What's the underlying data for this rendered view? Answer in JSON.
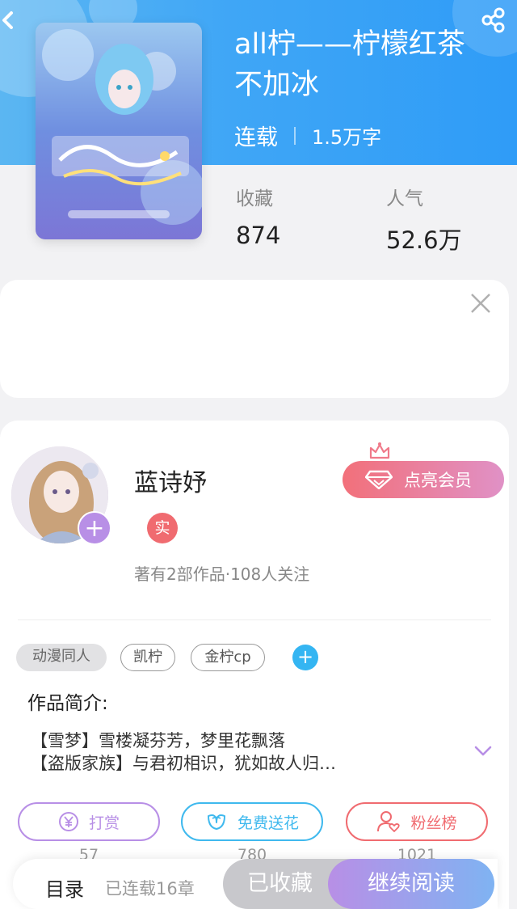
{
  "book": {
    "title": "all柠——柠檬红茶不加冰",
    "status": "连载",
    "word_count": "1.5万字",
    "stats": [
      {
        "label": "收藏",
        "value": "874"
      },
      {
        "label": "人气",
        "value": "52.6万"
      }
    ]
  },
  "author": {
    "name": "蓝诗妤",
    "verify_badge": "实",
    "info": "著有2部作品·108人关注",
    "vip_button": "点亮会员"
  },
  "tags": [
    "动漫同人",
    "凯柠",
    "金柠cp"
  ],
  "intro": {
    "title": "作品简介:",
    "lines": [
      "【雪梦】雪楼凝芬芳，梦里花飘落",
      "【盗版家族】与君初相识，犹如故人归…"
    ]
  },
  "actions": [
    {
      "label": "打赏",
      "count": "57",
      "color": "#b88fe6"
    },
    {
      "label": "免费送花",
      "count": "780",
      "color": "#3fb9ee"
    },
    {
      "label": "粉丝榜",
      "count": "1021",
      "color": "#f06b70"
    }
  ],
  "bottom_bar": {
    "toc_label": "目录",
    "toc_count": "已连载16章",
    "favorite": "已收藏",
    "continue_reading": "继续阅读"
  },
  "icons": {
    "back": "back-arrow-icon",
    "share": "share-icon",
    "close": "close-icon",
    "expand": "chevron-down-icon",
    "crown": "crown-icon",
    "diamond": "diamond-icon",
    "reward": "yen-coin-icon",
    "flower": "flower-icon",
    "fans": "user-heart-icon"
  }
}
